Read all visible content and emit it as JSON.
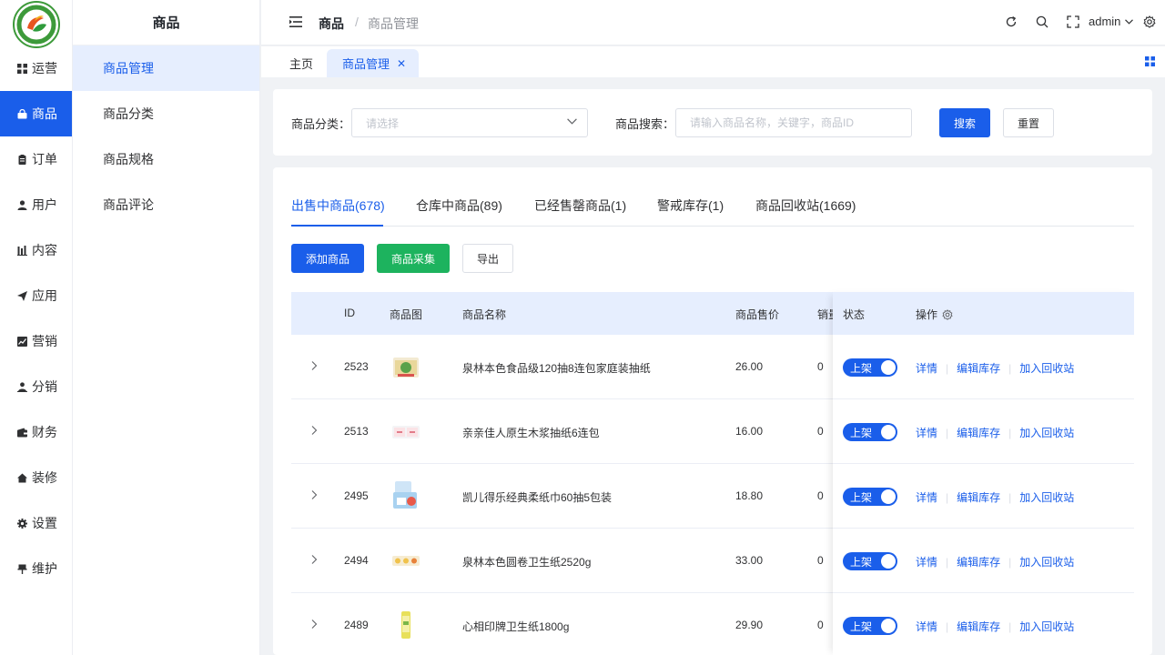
{
  "rail": {
    "items": [
      {
        "label": "运营",
        "icon": "grid-icon"
      },
      {
        "label": "商品",
        "icon": "bag-icon"
      },
      {
        "label": "订单",
        "icon": "clipboard-icon"
      },
      {
        "label": "用户",
        "icon": "user-icon"
      },
      {
        "label": "内容",
        "icon": "chart-bars-icon"
      },
      {
        "label": "应用",
        "icon": "send-icon"
      },
      {
        "label": "营销",
        "icon": "trend-icon"
      },
      {
        "label": "分销",
        "icon": "person-icon"
      },
      {
        "label": "财务",
        "icon": "wallet-icon"
      },
      {
        "label": "装修",
        "icon": "home-icon"
      },
      {
        "label": "设置",
        "icon": "gear-icon"
      },
      {
        "label": "维护",
        "icon": "pin-icon"
      }
    ],
    "active_index": 1
  },
  "submenu": {
    "title": "商品",
    "items": [
      "商品管理",
      "商品分类",
      "商品规格",
      "商品评论"
    ]
  },
  "header": {
    "breadcrumb_root": "商品",
    "breadcrumb_sep": "/",
    "breadcrumb_current": "商品管理",
    "username": "admin"
  },
  "tags": {
    "home": "主页",
    "active": "商品管理",
    "close": "✕"
  },
  "filter": {
    "category_label": "商品分类：",
    "category_placeholder": "请选择",
    "search_label": "商品搜索：",
    "search_placeholder": "请输入商品名称，关键字，商品ID",
    "search_button": "搜索",
    "reset_button": "重置"
  },
  "status_tabs": [
    "出售中商品(678)",
    "仓库中商品(89)",
    "已经售罄商品(1)",
    "警戒库存(1)",
    "商品回收站(1669)"
  ],
  "actions": {
    "add": "添加商品",
    "collect": "商品采集",
    "export": "导出"
  },
  "table": {
    "headers": {
      "id": "ID",
      "image": "商品图",
      "name": "商品名称",
      "price": "商品售价",
      "sales": "销量",
      "status": "状态",
      "ops": "操作"
    },
    "status_on": "上架",
    "op_detail": "详情",
    "op_edit_stock": "编辑库存",
    "op_recycle": "加入回收站",
    "op_divider": "|",
    "rows": [
      {
        "id": "2523",
        "name": "泉林本色食品级120抽8连包家庭装抽纸",
        "price": "26.00",
        "sales": "0"
      },
      {
        "id": "2513",
        "name": "亲亲佳人原生木浆抽纸6连包",
        "price": "16.00",
        "sales": "0"
      },
      {
        "id": "2495",
        "name": "凯儿得乐经典柔纸巾60抽5包装",
        "price": "18.80",
        "sales": "0"
      },
      {
        "id": "2494",
        "name": "泉林本色圆卷卫生纸2520g",
        "price": "33.00",
        "sales": "0"
      },
      {
        "id": "2489",
        "name": "心相印牌卫生纸1800g",
        "price": "29.90",
        "sales": "0"
      }
    ]
  },
  "colors": {
    "primary": "#1a5eea",
    "success": "#1db35e",
    "active_bg": "#e6eefe"
  }
}
